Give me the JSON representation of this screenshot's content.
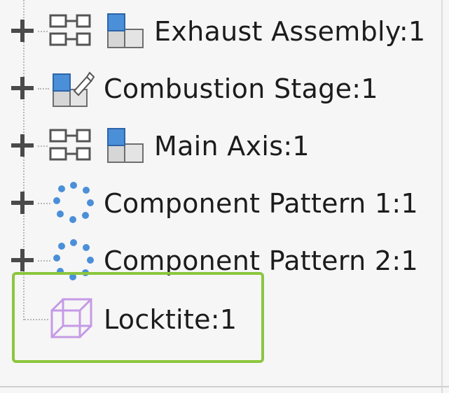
{
  "tree": {
    "items": [
      {
        "label": "Exhaust Assembly:1",
        "icon": "subassembly-icon",
        "expandable": true
      },
      {
        "label": "Combustion Stage:1",
        "icon": "editable-assembly-icon",
        "expandable": true
      },
      {
        "label": "Main Axis:1",
        "icon": "subassembly-icon",
        "expandable": true
      },
      {
        "label": "Component Pattern 1:1",
        "icon": "component-pattern-icon",
        "expandable": true
      },
      {
        "label": "Component Pattern 2:1",
        "icon": "component-pattern-icon",
        "expandable": true
      },
      {
        "label": "Locktite:1",
        "icon": "transparent-part-icon",
        "expandable": false,
        "highlighted": true
      }
    ]
  },
  "colors": {
    "highlight_border": "#8cc63e",
    "icon_blue": "#4b8fd8",
    "icon_purple": "#c59ae6",
    "expander": "#4a4a4a"
  }
}
